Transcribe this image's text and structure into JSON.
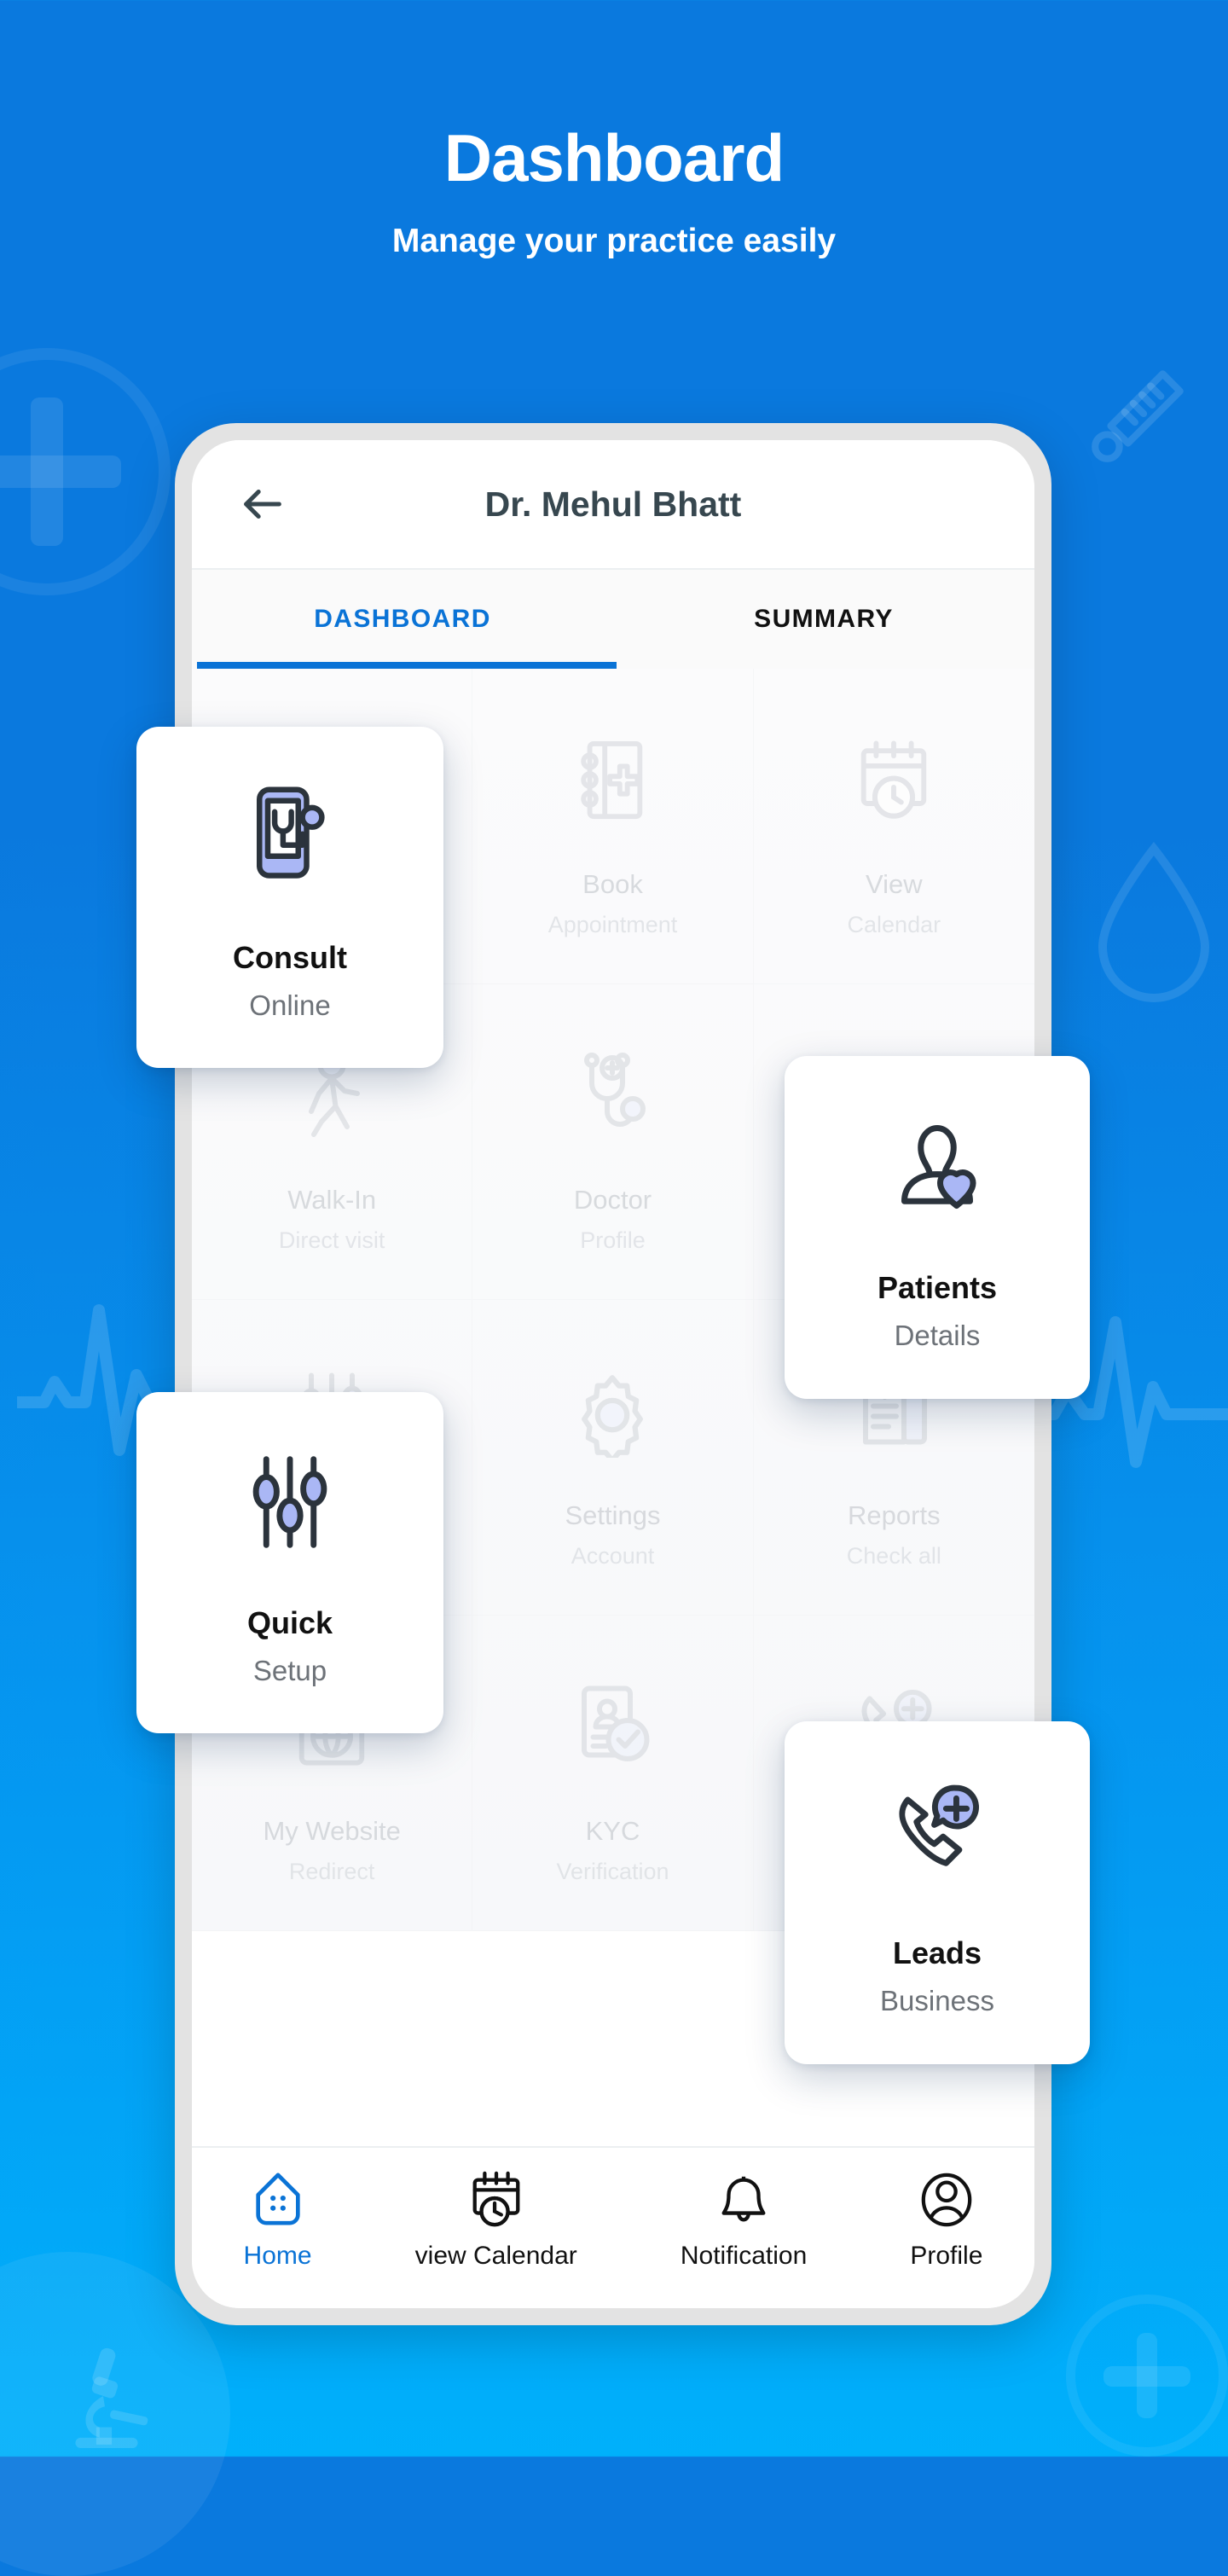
{
  "hero": {
    "title": "Dashboard",
    "subtitle": "Manage your practice easily"
  },
  "colors": {
    "brand_blue": "#0a79de",
    "bottom_blue": "#00b0fb",
    "accent": "#0a73d6",
    "icon_dark": "#2b333c",
    "icon_periwinkle": "#aab7f5",
    "muted": "#c3c7cc"
  },
  "app_bar": {
    "back_icon": "arrow-left-icon",
    "title": "Dr. Mehul Bhatt"
  },
  "tabs": [
    {
      "label": "DASHBOARD",
      "active": true
    },
    {
      "label": "SUMMARY",
      "active": false
    }
  ],
  "tiles": [
    {
      "icon": "phone-stethoscope-icon",
      "title": "Consult",
      "sub": "Online",
      "highlighted": true
    },
    {
      "icon": "medical-book-icon",
      "title": "Book",
      "sub": "Appointment",
      "highlighted": false
    },
    {
      "icon": "calendar-clock-icon",
      "title": "View",
      "sub": "Calendar",
      "highlighted": false
    },
    {
      "icon": "walking-person-icon",
      "title": "Walk-In",
      "sub": "Direct visit",
      "highlighted": false
    },
    {
      "icon": "stethoscope-icon",
      "title": "Doctor",
      "sub": "Profile",
      "highlighted": false
    },
    {
      "icon": "person-heart-icon",
      "title": "Patients",
      "sub": "Details",
      "highlighted": true
    },
    {
      "icon": "sliders-icon",
      "title": "Quick",
      "sub": "Setup",
      "highlighted": true
    },
    {
      "icon": "gear-icon",
      "title": "Settings",
      "sub": "Account",
      "highlighted": false
    },
    {
      "icon": "report-document-icon",
      "title": "Reports",
      "sub": "Check all",
      "highlighted": false
    },
    {
      "icon": "browser-globe-icon",
      "title": "My Website",
      "sub": "Redirect",
      "highlighted": false
    },
    {
      "icon": "id-card-check-icon",
      "title": "KYC",
      "sub": "Verification",
      "highlighted": false
    },
    {
      "icon": "phone-add-icon",
      "title": "Leads",
      "sub": "Business",
      "highlighted": true
    }
  ],
  "floating_cards": [
    {
      "id": "consult",
      "icon": "phone-stethoscope-icon",
      "title": "Consult",
      "sub": "Online"
    },
    {
      "id": "patients",
      "icon": "person-heart-icon",
      "title": "Patients",
      "sub": "Details"
    },
    {
      "id": "quick",
      "icon": "sliders-icon",
      "title": "Quick",
      "sub": "Setup"
    },
    {
      "id": "leads",
      "icon": "phone-add-icon",
      "title": "Leads",
      "sub": "Business"
    }
  ],
  "bottom_nav": [
    {
      "icon": "home-icon",
      "label": "Home",
      "active": true
    },
    {
      "icon": "calendar-clock-icon",
      "label": "view Calendar",
      "active": false
    },
    {
      "icon": "bell-icon",
      "label": "Notification",
      "active": false
    },
    {
      "icon": "profile-icon",
      "label": "Profile",
      "active": false
    }
  ],
  "decorations": [
    {
      "name": "plus-circle-top-left"
    },
    {
      "name": "thermometer-top-right"
    },
    {
      "name": "water-drop-right"
    },
    {
      "name": "ecg-pulse-left"
    },
    {
      "name": "ecg-pulse-right"
    },
    {
      "name": "microscope-bottom-left"
    },
    {
      "name": "plus-circle-bottom-right"
    }
  ]
}
